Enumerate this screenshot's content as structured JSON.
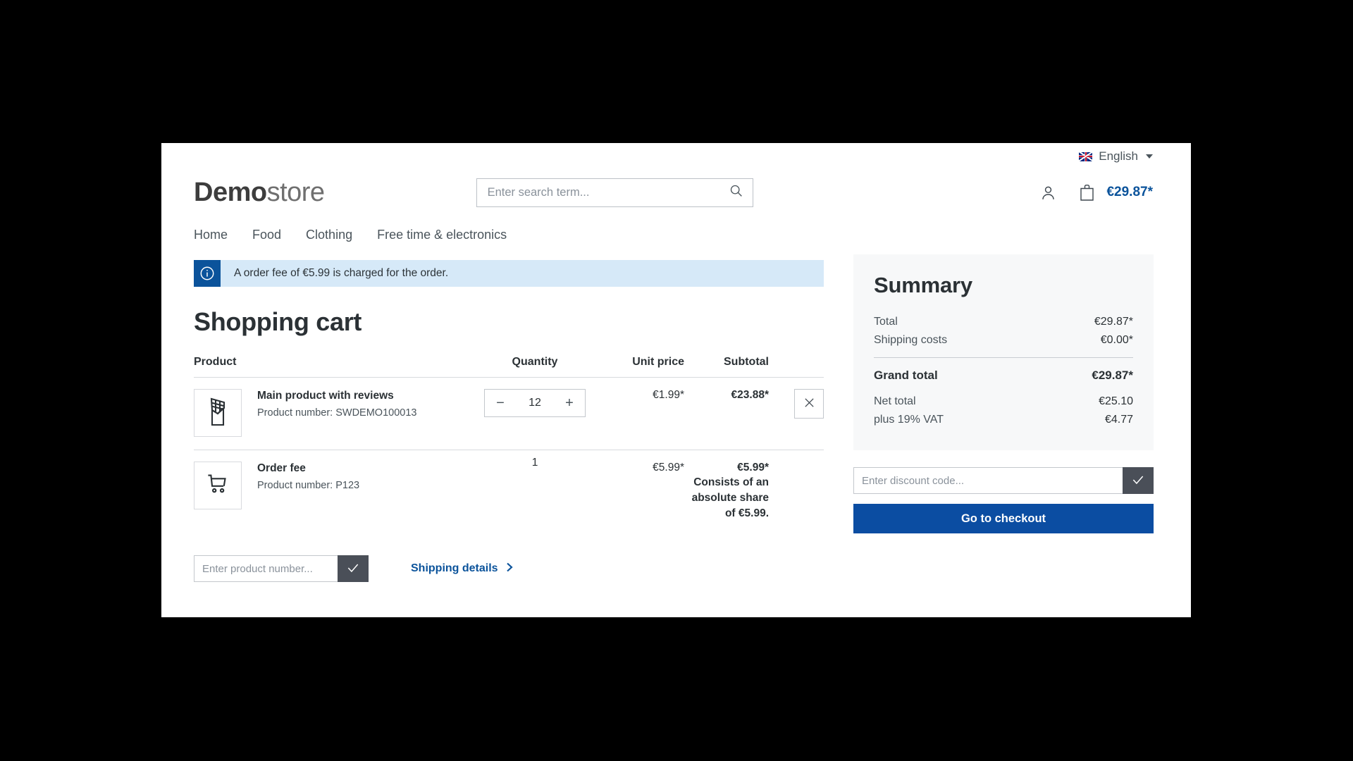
{
  "topbar": {
    "language": "English",
    "flag_icon": "uk-flag-icon",
    "caret_icon": "chevron-down-icon"
  },
  "header": {
    "logo_bold": "Demo",
    "logo_light": "store",
    "search": {
      "placeholder": "Enter search term...",
      "value": "",
      "icon": "search-icon"
    },
    "account_icon": "user-icon",
    "cart_icon": "shopping-bag-icon",
    "cart_total": "€29.87*"
  },
  "nav": {
    "items": [
      {
        "label": "Home"
      },
      {
        "label": "Food"
      },
      {
        "label": "Clothing"
      },
      {
        "label": "Free time & electronics"
      }
    ]
  },
  "alert": {
    "icon": "info-circle-icon",
    "message": "A order fee of €5.99 is charged for the order."
  },
  "cart": {
    "title": "Shopping cart",
    "columns": {
      "product": "Product",
      "quantity": "Quantity",
      "unit_price": "Unit price",
      "subtotal": "Subtotal"
    },
    "rows": [
      {
        "thumb_icon": "chocolate-bar-icon",
        "name": "Main product with reviews",
        "product_number": "Product number: SWDEMO100013",
        "quantity": "12",
        "minus_label": "−",
        "plus_label": "+",
        "unit_price": "€1.99*",
        "subtotal": "€23.88*",
        "subtotal_note": "",
        "remove_icon": "close-icon"
      },
      {
        "thumb_icon": "shopping-cart-icon",
        "name": "Order fee",
        "product_number": "Product number: P123",
        "quantity": "1",
        "unit_price": "€5.99*",
        "subtotal": "€5.99*",
        "subtotal_note": "Consists of an absolute share of €5.99."
      }
    ],
    "product_number_input": {
      "placeholder": "Enter product number...",
      "value": "",
      "submit_icon": "check-icon"
    },
    "shipping_details": {
      "label": "Shipping details",
      "icon": "chevron-right-icon"
    }
  },
  "summary": {
    "title": "Summary",
    "lines": [
      {
        "label": "Total",
        "value": "€29.87*"
      },
      {
        "label": "Shipping costs",
        "value": "€0.00*"
      }
    ],
    "grand_total": {
      "label": "Grand total",
      "value": "€29.87*"
    },
    "net_lines": [
      {
        "label": "Net total",
        "value": "€25.10"
      },
      {
        "label": "plus 19% VAT",
        "value": "€4.77"
      }
    ],
    "discount_input": {
      "placeholder": "Enter discount code...",
      "value": "",
      "submit_icon": "check-icon"
    },
    "checkout_label": "Go to checkout"
  },
  "colors": {
    "brand_blue": "#0b4da2",
    "link_blue": "#0b539b",
    "alert_bg": "#d6e9f8",
    "summary_bg": "#f7f8f9",
    "dark_button": "#4a4f58"
  }
}
